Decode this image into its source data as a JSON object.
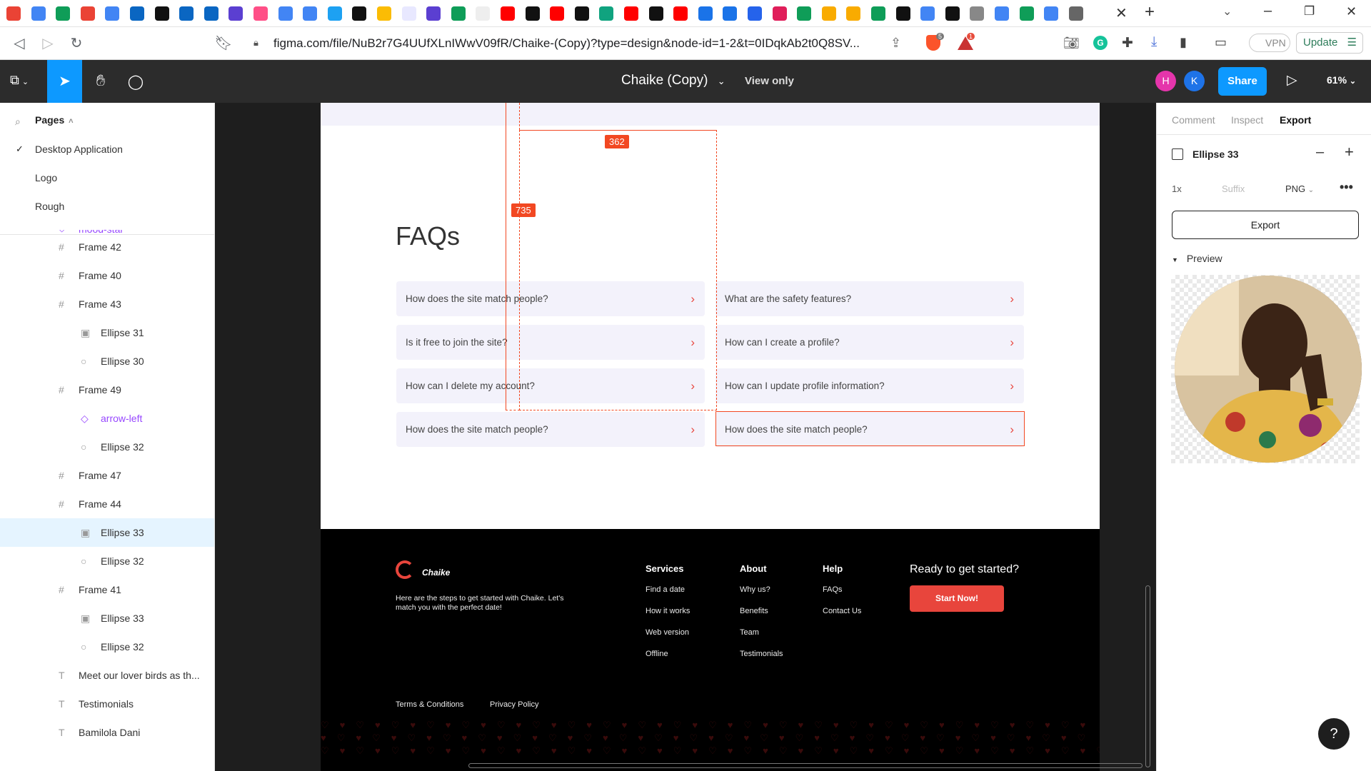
{
  "browser": {
    "url": "figma.com/file/NuB2r7G4UUfXLnIWwV09fR/Chaike-(Copy)?type=design&node-id=1-2&t=0IDqkAb2t0Q8SV...",
    "vpn_label": "VPN",
    "update_label": "Update",
    "brave_badge": "5",
    "alert_badge": "1"
  },
  "figma": {
    "file_title": "Chaike (Copy)",
    "view_mode": "View only",
    "avatars": [
      "H",
      "K"
    ],
    "share_label": "Share",
    "zoom": "61%"
  },
  "left_panel": {
    "pages_label": "Pages",
    "pages": [
      "Desktop Application",
      "Logo",
      "Rough"
    ],
    "layers_partial": "mood-star",
    "layers": [
      {
        "name": "Frame 42",
        "type": "frame",
        "indent": 0
      },
      {
        "name": "Frame 40",
        "type": "frame",
        "indent": 0
      },
      {
        "name": "Frame 43",
        "type": "frame",
        "indent": 0
      },
      {
        "name": "Ellipse 31",
        "type": "image",
        "indent": 1
      },
      {
        "name": "Ellipse 30",
        "type": "ellipse",
        "indent": 1
      },
      {
        "name": "Frame 49",
        "type": "frame",
        "indent": 0
      },
      {
        "name": "arrow-left",
        "type": "component",
        "indent": 1
      },
      {
        "name": "Ellipse 32",
        "type": "ellipse",
        "indent": 1
      },
      {
        "name": "Frame 47",
        "type": "frame",
        "indent": 0
      },
      {
        "name": "Frame 44",
        "type": "frame",
        "indent": 0
      },
      {
        "name": "Ellipse 33",
        "type": "image",
        "indent": 1,
        "selected": true
      },
      {
        "name": "Ellipse 32",
        "type": "ellipse",
        "indent": 1
      },
      {
        "name": "Frame 41",
        "type": "frame",
        "indent": 0
      },
      {
        "name": "Ellipse 33",
        "type": "image",
        "indent": 1
      },
      {
        "name": "Ellipse 32",
        "type": "ellipse",
        "indent": 1
      },
      {
        "name": "Meet our lover birds as th...",
        "type": "text",
        "indent": 0
      },
      {
        "name": "Testimonials",
        "type": "text",
        "indent": 0
      },
      {
        "name": "Bamilola Dani",
        "type": "text",
        "indent": 0
      }
    ]
  },
  "canvas": {
    "measure_width": "362",
    "measure_height": "735",
    "faq_title": "FAQs",
    "faqs_left": [
      "How does the site match people?",
      "Is it free to join the site?",
      "How can I delete my account?",
      "How does the site match people?"
    ],
    "faqs_right": [
      "What are the safety features?",
      "How can I create a profile?",
      "How can I update profile information?",
      "How does the site match people?"
    ],
    "footer": {
      "brand": "Chaike",
      "tagline": "Here are the steps to get started with Chaike. Let's match you with the perfect date!",
      "services_heading": "Services",
      "services": [
        "Find a date",
        "How it works",
        "Web version",
        "Offline"
      ],
      "about_heading": "About",
      "about": [
        "Why us?",
        "Benefits",
        "Team",
        "Testimonials"
      ],
      "help_heading": "Help",
      "help": [
        "FAQs",
        "Contact Us"
      ],
      "cta_heading": "Ready to get started?",
      "cta_button": "Start Now!",
      "terms": "Terms & Conditions",
      "privacy": "Privacy Policy"
    }
  },
  "right_panel": {
    "tabs": [
      "Comment",
      "Inspect",
      "Export"
    ],
    "layer_name": "Ellipse 33",
    "scale": "1x",
    "suffix_placeholder": "Suffix",
    "format": "PNG",
    "export_label": "Export",
    "preview_label": "Preview"
  },
  "help_button": "?"
}
